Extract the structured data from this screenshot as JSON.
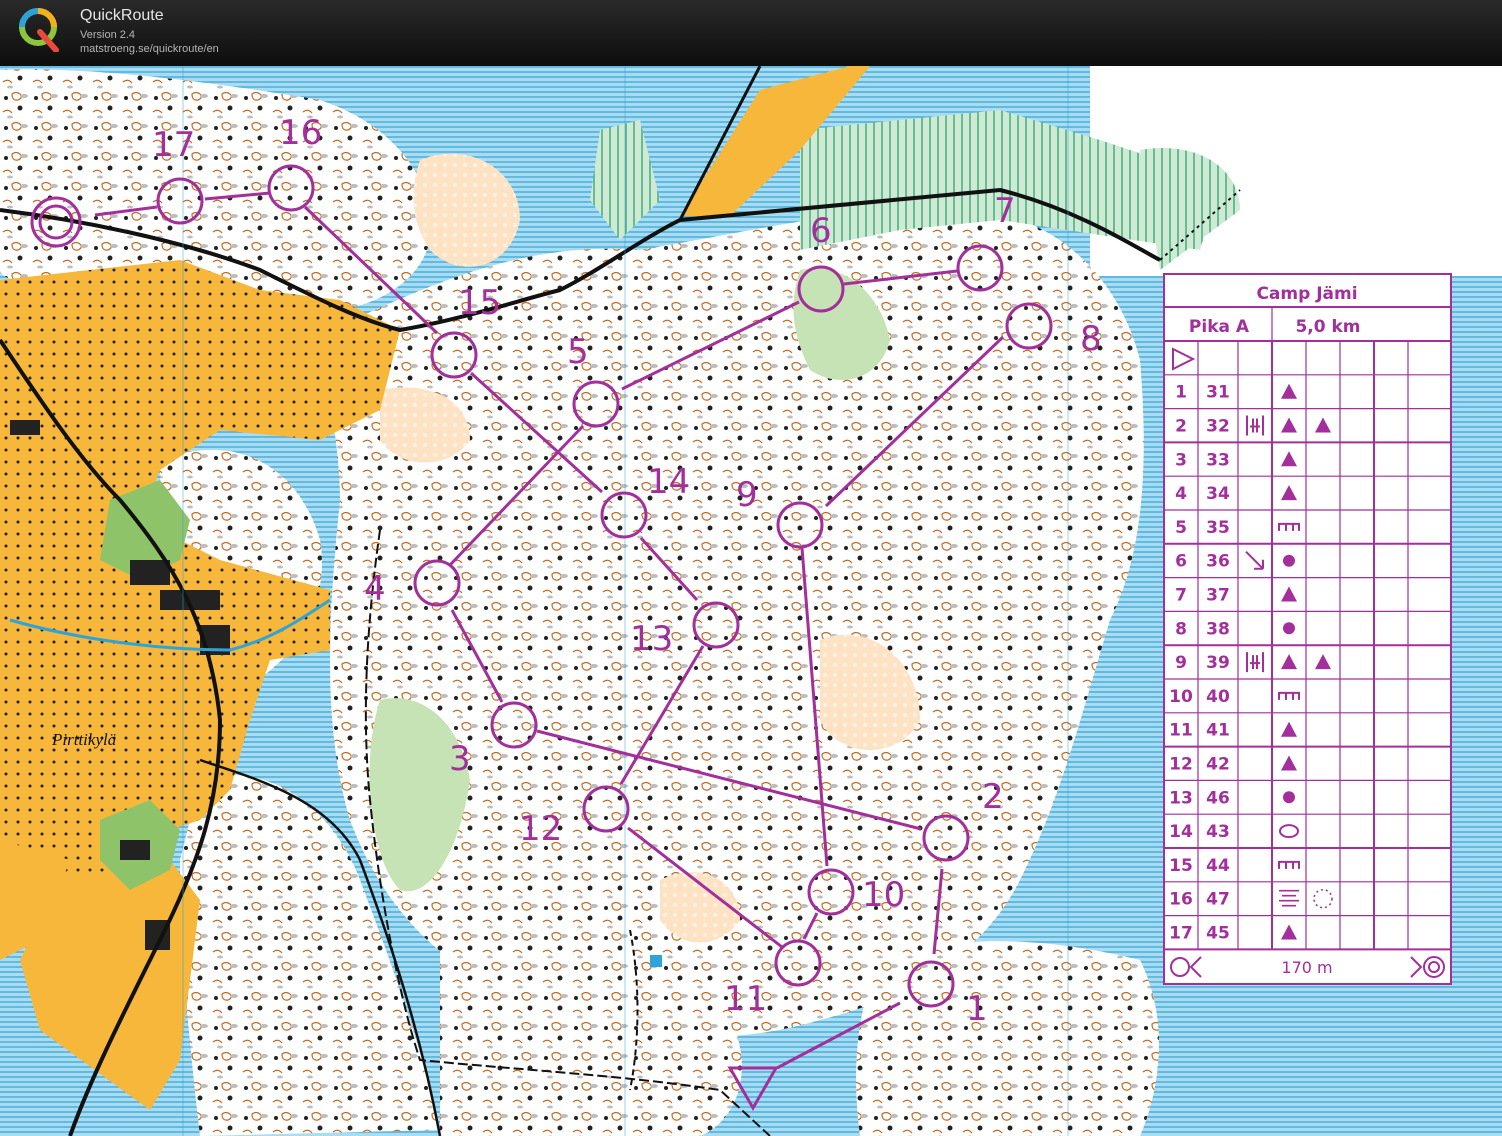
{
  "titlebar": {
    "app_name": "QuickRoute",
    "version": "Version 2.4",
    "url": "matstroeng.se/quickroute/en",
    "logo_letter": "Q"
  },
  "map": {
    "place_name": "Pirttikylä",
    "course_color": "#a22f9b",
    "control_numbers": [
      "1",
      "2",
      "3",
      "4",
      "5",
      "6",
      "7",
      "8",
      "9",
      "10",
      "11",
      "12",
      "13",
      "14",
      "15",
      "16",
      "17"
    ]
  },
  "control_card": {
    "event_name": "Camp Jämi",
    "course_name": "Pika A",
    "course_length": "5,0 km",
    "finish_distance": "170 m",
    "rows": [
      {
        "num": "1",
        "code": "31",
        "symbols": [
          "triangle"
        ]
      },
      {
        "num": "2",
        "code": "32",
        "symbols": [
          "between-icon",
          "triangle",
          "triangle"
        ]
      },
      {
        "num": "3",
        "code": "33",
        "symbols": [
          "triangle"
        ]
      },
      {
        "num": "4",
        "code": "34",
        "symbols": [
          "triangle"
        ]
      },
      {
        "num": "5",
        "code": "35",
        "symbols": [
          "ruin-icon"
        ]
      },
      {
        "num": "6",
        "code": "36",
        "symbols": [
          "arrow-se-icon",
          "dot"
        ]
      },
      {
        "num": "7",
        "code": "37",
        "symbols": [
          "triangle"
        ]
      },
      {
        "num": "8",
        "code": "38",
        "symbols": [
          "dot"
        ]
      },
      {
        "num": "9",
        "code": "39",
        "symbols": [
          "between-icon",
          "triangle",
          "triangle"
        ]
      },
      {
        "num": "10",
        "code": "40",
        "symbols": [
          "ruin-icon"
        ]
      },
      {
        "num": "11",
        "code": "41",
        "symbols": [
          "triangle"
        ]
      },
      {
        "num": "12",
        "code": "42",
        "symbols": [
          "triangle"
        ]
      },
      {
        "num": "13",
        "code": "46",
        "symbols": [
          "dot"
        ]
      },
      {
        "num": "14",
        "code": "43",
        "symbols": [
          "ellipse"
        ]
      },
      {
        "num": "15",
        "code": "44",
        "symbols": [
          "ruin-icon"
        ]
      },
      {
        "num": "16",
        "code": "47",
        "symbols": [
          "marsh-icon",
          "dotted-circle"
        ]
      },
      {
        "num": "17",
        "code": "45",
        "symbols": [
          "triangle"
        ]
      }
    ]
  }
}
